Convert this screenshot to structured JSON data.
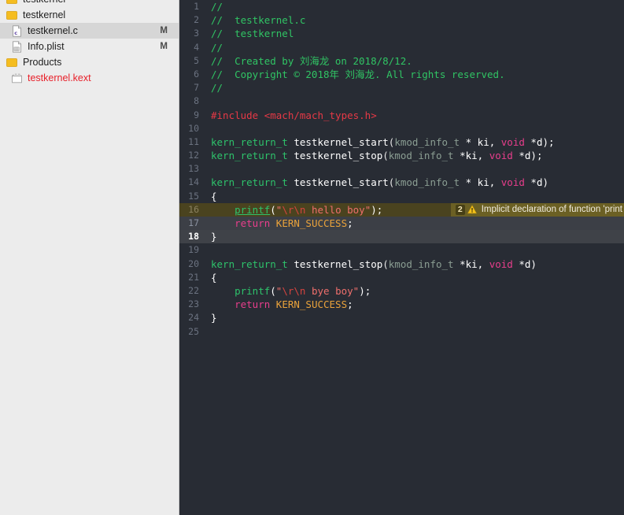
{
  "sidebar": {
    "rows": [
      {
        "id": "project-root",
        "icon": "folder-icon",
        "label": "testkernel",
        "badge": "",
        "selected": false,
        "indent": 1,
        "clipped": true,
        "kext": false
      },
      {
        "id": "group-testkernel",
        "icon": "folder-icon",
        "label": "testkernel",
        "badge": "",
        "selected": false,
        "indent": 1,
        "clipped": false,
        "kext": false
      },
      {
        "id": "file-testkernel-c",
        "icon": "c-source-file-icon",
        "label": "testkernel.c",
        "badge": "M",
        "selected": true,
        "indent": 2,
        "clipped": false,
        "kext": false
      },
      {
        "id": "file-info-plist",
        "icon": "plist-file-icon",
        "label": "Info.plist",
        "badge": "M",
        "selected": false,
        "indent": 2,
        "clipped": false,
        "kext": false
      },
      {
        "id": "group-products",
        "icon": "folder-icon",
        "label": "Products",
        "badge": "",
        "selected": false,
        "indent": 1,
        "clipped": false,
        "kext": false
      },
      {
        "id": "product-testkernel-kext",
        "icon": "product-box-icon",
        "label": "testkernel.kext",
        "badge": "",
        "selected": false,
        "indent": 2,
        "clipped": false,
        "kext": true
      }
    ]
  },
  "editor": {
    "filename": "testkernel.c",
    "first_visible_line": 1,
    "last_visible_line": 25,
    "warning": {
      "line": 16,
      "count": "2",
      "icon": "warning-triangle-icon",
      "message": "Implicit declaration of function 'print"
    },
    "cursor_line": 18,
    "selected_lines": [
      16,
      17,
      18
    ],
    "colors": {
      "background": "#282c34",
      "comment": "#30c464",
      "preprocessor": "#e63946",
      "type": "#2ec26b",
      "keyword": "#e83e8c",
      "function": "#2ec26b",
      "string": "#ef6f6c",
      "escape": "#d6443f",
      "constant": "#e9a23b",
      "identifier": "#ffffff",
      "warning_band": "#4a431f",
      "warning_banner": "#6b6024",
      "cursor_line": "#3f4248"
    },
    "lines": [
      {
        "n": "1",
        "tokens": [
          {
            "t": "//",
            "c": "c-comment"
          }
        ]
      },
      {
        "n": "2",
        "tokens": [
          {
            "t": "//  testkernel.c",
            "c": "c-comment"
          }
        ]
      },
      {
        "n": "3",
        "tokens": [
          {
            "t": "//  testkernel",
            "c": "c-comment"
          }
        ]
      },
      {
        "n": "4",
        "tokens": [
          {
            "t": "//",
            "c": "c-comment"
          }
        ]
      },
      {
        "n": "5",
        "tokens": [
          {
            "t": "//  Created by 刘海龙 on 2018/8/12.",
            "c": "c-comment"
          }
        ]
      },
      {
        "n": "6",
        "tokens": [
          {
            "t": "//  Copyright © 2018年 刘海龙. All rights reserved.",
            "c": "c-comment"
          }
        ]
      },
      {
        "n": "7",
        "tokens": [
          {
            "t": "//",
            "c": "c-comment"
          }
        ]
      },
      {
        "n": "8",
        "tokens": []
      },
      {
        "n": "9",
        "tokens": [
          {
            "t": "#include ",
            "c": "c-pre"
          },
          {
            "t": "<mach/mach_types.h>",
            "c": "c-hdr"
          }
        ]
      },
      {
        "n": "10",
        "tokens": []
      },
      {
        "n": "11",
        "tokens": [
          {
            "t": "kern_return_t ",
            "c": "c-type"
          },
          {
            "t": "testkernel_start",
            "c": "c-id"
          },
          {
            "t": "(",
            "c": "c-plain"
          },
          {
            "t": "kmod_info_t ",
            "c": "c-ftype"
          },
          {
            "t": "* ki, ",
            "c": "c-id"
          },
          {
            "t": "void ",
            "c": "c-kw"
          },
          {
            "t": "*d);",
            "c": "c-id"
          }
        ]
      },
      {
        "n": "12",
        "tokens": [
          {
            "t": "kern_return_t ",
            "c": "c-type"
          },
          {
            "t": "testkernel_stop",
            "c": "c-id"
          },
          {
            "t": "(",
            "c": "c-plain"
          },
          {
            "t": "kmod_info_t ",
            "c": "c-ftype"
          },
          {
            "t": "*ki, ",
            "c": "c-id"
          },
          {
            "t": "void ",
            "c": "c-kw"
          },
          {
            "t": "*d);",
            "c": "c-id"
          }
        ]
      },
      {
        "n": "13",
        "tokens": []
      },
      {
        "n": "14",
        "tokens": [
          {
            "t": "kern_return_t ",
            "c": "c-type"
          },
          {
            "t": "testkernel_start",
            "c": "c-id"
          },
          {
            "t": "(",
            "c": "c-plain"
          },
          {
            "t": "kmod_info_t ",
            "c": "c-ftype"
          },
          {
            "t": "* ki, ",
            "c": "c-id"
          },
          {
            "t": "void ",
            "c": "c-kw"
          },
          {
            "t": "*d)",
            "c": "c-id"
          }
        ]
      },
      {
        "n": "15",
        "tokens": [
          {
            "t": "{",
            "c": "c-id"
          }
        ]
      },
      {
        "n": "16",
        "state": "warn",
        "tokens": [
          {
            "t": "    ",
            "c": "c-plain"
          },
          {
            "t": "printf",
            "c": "c-fn-u"
          },
          {
            "t": "(",
            "c": "c-id"
          },
          {
            "t": "\"",
            "c": "c-str"
          },
          {
            "t": "\\r",
            "c": "c-esc"
          },
          {
            "t": "\\n",
            "c": "c-esc"
          },
          {
            "t": " hello boy\"",
            "c": "c-str"
          },
          {
            "t": ");",
            "c": "c-id"
          }
        ]
      },
      {
        "n": "17",
        "state": "sel",
        "tokens": [
          {
            "t": "    ",
            "c": "c-plain"
          },
          {
            "t": "return ",
            "c": "c-kw"
          },
          {
            "t": "KERN_SUCCESS",
            "c": "c-const"
          },
          {
            "t": ";",
            "c": "c-id"
          }
        ]
      },
      {
        "n": "18",
        "state": "cursor",
        "tokens": [
          {
            "t": "}",
            "c": "c-id"
          }
        ]
      },
      {
        "n": "19",
        "tokens": []
      },
      {
        "n": "20",
        "tokens": [
          {
            "t": "kern_return_t ",
            "c": "c-type"
          },
          {
            "t": "testkernel_stop",
            "c": "c-id"
          },
          {
            "t": "(",
            "c": "c-plain"
          },
          {
            "t": "kmod_info_t ",
            "c": "c-ftype"
          },
          {
            "t": "*ki, ",
            "c": "c-id"
          },
          {
            "t": "void ",
            "c": "c-kw"
          },
          {
            "t": "*d)",
            "c": "c-id"
          }
        ]
      },
      {
        "n": "21",
        "tokens": [
          {
            "t": "{",
            "c": "c-id"
          }
        ]
      },
      {
        "n": "22",
        "tokens": [
          {
            "t": "    ",
            "c": "c-plain"
          },
          {
            "t": "printf",
            "c": "c-fn"
          },
          {
            "t": "(",
            "c": "c-id"
          },
          {
            "t": "\"",
            "c": "c-str"
          },
          {
            "t": "\\r",
            "c": "c-esc"
          },
          {
            "t": "\\n",
            "c": "c-esc"
          },
          {
            "t": " bye boy\"",
            "c": "c-str"
          },
          {
            "t": ");",
            "c": "c-id"
          }
        ]
      },
      {
        "n": "23",
        "tokens": [
          {
            "t": "    ",
            "c": "c-plain"
          },
          {
            "t": "return ",
            "c": "c-kw"
          },
          {
            "t": "KERN_SUCCESS",
            "c": "c-const"
          },
          {
            "t": ";",
            "c": "c-id"
          }
        ]
      },
      {
        "n": "24",
        "tokens": [
          {
            "t": "}",
            "c": "c-id"
          }
        ]
      },
      {
        "n": "25",
        "tokens": []
      }
    ]
  }
}
